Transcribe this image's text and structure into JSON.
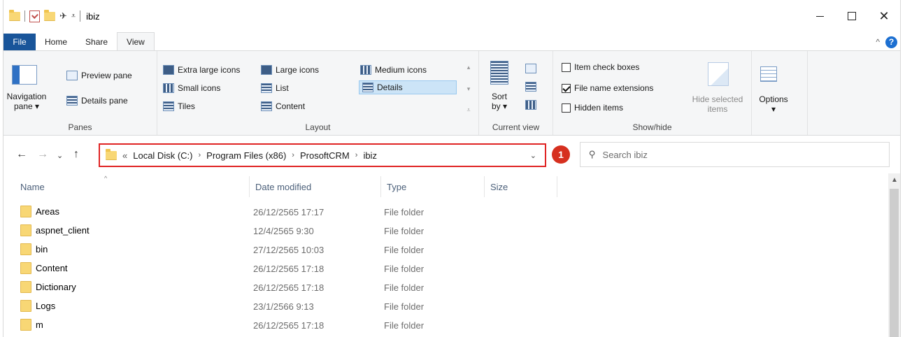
{
  "window": {
    "title": "ibiz"
  },
  "tabs": {
    "file": "File",
    "home": "Home",
    "share": "Share",
    "view": "View"
  },
  "ribbon": {
    "panes": {
      "navigation_pane": "Navigation",
      "navigation_pane_2": "pane ▾",
      "preview_pane": "Preview pane",
      "details_pane": "Details pane",
      "label": "Panes"
    },
    "layout": {
      "extra_large_icons": "Extra large icons",
      "large_icons": "Large icons",
      "medium_icons": "Medium icons",
      "small_icons": "Small icons",
      "list": "List",
      "details": "Details",
      "tiles": "Tiles",
      "content": "Content",
      "label": "Layout"
    },
    "current_view": {
      "sort_by": "Sort",
      "sort_by_2": "by ▾",
      "label": "Current view"
    },
    "show_hide": {
      "item_check_boxes": "Item check boxes",
      "file_name_extensions": "File name extensions",
      "hidden_items": "Hidden items",
      "hide_selected": "Hide selected",
      "hide_selected_2": "items",
      "label": "Show/hide"
    },
    "options": {
      "label": "Options",
      "arrow": "▾"
    }
  },
  "address": {
    "crumbs": [
      "Local Disk (C:)",
      "Program Files (x86)",
      "ProsoftCRM",
      "ibiz"
    ],
    "badge": "1"
  },
  "search": {
    "placeholder": "Search ibiz"
  },
  "columns": {
    "name": "Name",
    "date": "Date modified",
    "type": "Type",
    "size": "Size"
  },
  "files": [
    {
      "name": "Areas",
      "date": "26/12/2565 17:17",
      "type": "File folder"
    },
    {
      "name": "aspnet_client",
      "date": "12/4/2565 9:30",
      "type": "File folder"
    },
    {
      "name": "bin",
      "date": "27/12/2565 10:03",
      "type": "File folder"
    },
    {
      "name": "Content",
      "date": "26/12/2565 17:18",
      "type": "File folder"
    },
    {
      "name": "Dictionary",
      "date": "26/12/2565 17:18",
      "type": "File folder"
    },
    {
      "name": "Logs",
      "date": "23/1/2566 9:13",
      "type": "File folder"
    },
    {
      "name": "m",
      "date": "26/12/2565 17:18",
      "type": "File folder"
    }
  ],
  "colors": {
    "file_tab": "#19559a",
    "highlight_box": "#e02424",
    "badge": "#d6301f",
    "folder": "#f8d775"
  }
}
